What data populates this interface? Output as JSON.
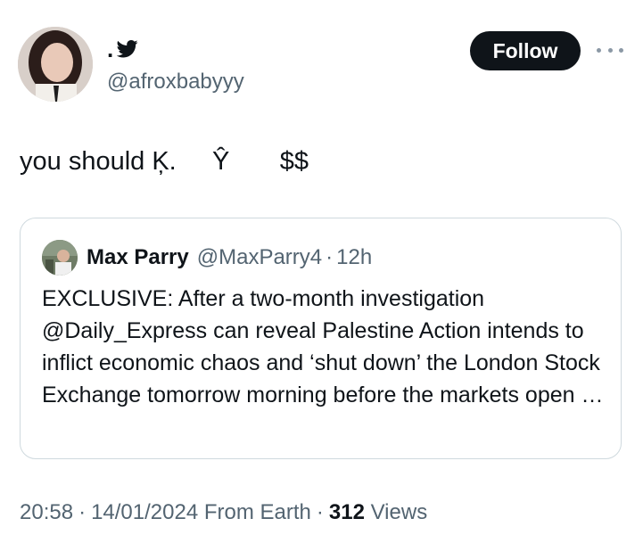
{
  "user": {
    "display_name": ".",
    "handle": "@afroxbabyyy"
  },
  "actions": {
    "follow_label": "Follow"
  },
  "tweet": {
    "text": "you should Ķ.     Ŷ       $$"
  },
  "quoted_tweet": {
    "author_name": "Max Parry",
    "author_handle": "@MaxParry4",
    "separator": "·",
    "time_ago": "12h",
    "text": "EXCLUSIVE: After a two-month investigation @Daily_Express can reveal Palestine Action intends to inflict economic chaos and ‘shut down’ the London Stock Exchange tomorrow morning before the markets open …"
  },
  "meta": {
    "time": "20:58",
    "separator": "·",
    "date": "14/01/2024",
    "source": "From Earth",
    "views_count": "312",
    "views_label": "Views"
  },
  "colors": {
    "text_primary": "#0f1419",
    "text_secondary": "#536471",
    "border": "#cfd9de",
    "follow_bg": "#0f1419"
  },
  "icons": {
    "verified": "twitter-bird-icon",
    "more": "more-horizontal-icon"
  }
}
